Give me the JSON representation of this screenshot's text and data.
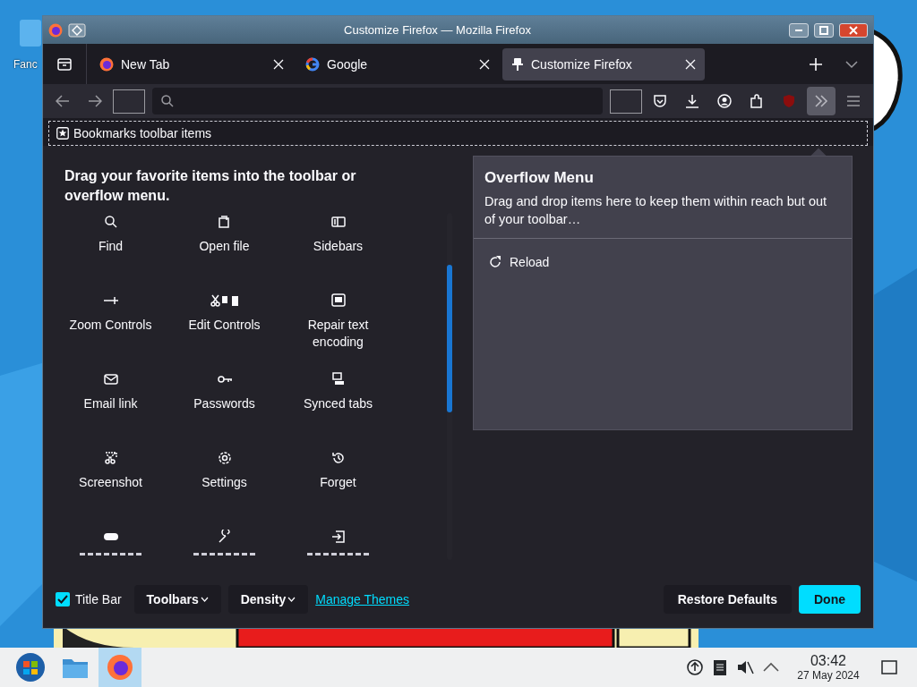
{
  "window": {
    "title": "Customize Firefox — Mozilla Firefox"
  },
  "desktop": {
    "icons": [
      {
        "label": "Fanc"
      }
    ]
  },
  "tabs": [
    {
      "label": "New Tab",
      "selected": false
    },
    {
      "label": "Google",
      "selected": false
    },
    {
      "label": "Customize Firefox",
      "selected": true
    }
  ],
  "bookmarks_toolbar": {
    "label": "Bookmarks toolbar items"
  },
  "palette": {
    "heading": "Drag your favorite items into the toolbar or overflow menu.",
    "items": [
      {
        "label": "Find"
      },
      {
        "label": "Open file"
      },
      {
        "label": "Sidebars"
      },
      {
        "label": "Zoom Controls"
      },
      {
        "label": "Edit Controls"
      },
      {
        "label": "Repair text encoding"
      },
      {
        "label": "Email link"
      },
      {
        "label": "Passwords"
      },
      {
        "label": "Synced tabs"
      },
      {
        "label": "Screenshot"
      },
      {
        "label": "Settings"
      },
      {
        "label": "Forget"
      },
      {
        "kind": "cut"
      },
      {
        "kind": "cut"
      },
      {
        "kind": "cut"
      }
    ]
  },
  "overflow": {
    "title": "Overflow Menu",
    "description": "Drag and drop items here to keep them within reach but out of your toolbar…",
    "items": [
      {
        "label": "Reload"
      }
    ]
  },
  "footer": {
    "title_bar": {
      "label": "Title Bar",
      "checked": true
    },
    "toolbars": "Toolbars",
    "density": "Density",
    "manage_themes": "Manage Themes",
    "restore": "Restore Defaults",
    "done": "Done"
  },
  "taskbar": {
    "apps": [
      {
        "selected": false
      },
      {
        "selected": false
      },
      {
        "selected": true
      }
    ],
    "time": "03:42",
    "date": "27 May 2024"
  }
}
